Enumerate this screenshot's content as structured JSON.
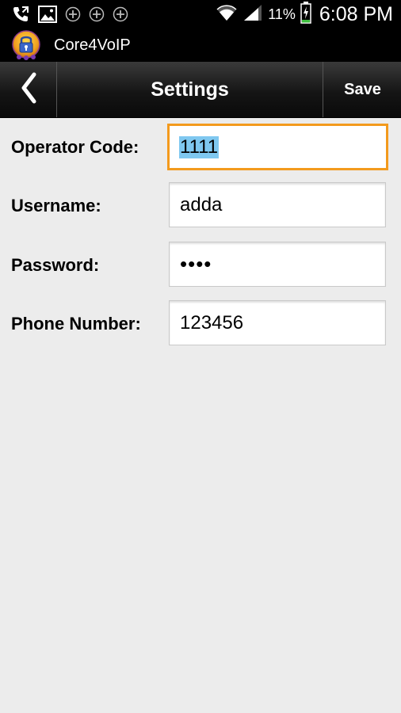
{
  "status_bar": {
    "battery_percent": "11%",
    "time": "6:08 PM",
    "icons": [
      "phone-call-icon",
      "image-icon",
      "add-circle-icon",
      "add-circle-icon",
      "add-circle-icon",
      "wifi-icon",
      "signal-icon",
      "battery-charging-icon"
    ]
  },
  "app": {
    "name": "Core4VoIP",
    "logo_icon": "lock-logo-icon"
  },
  "action_bar": {
    "back_icon": "chevron-left-icon",
    "title": "Settings",
    "save_label": "Save"
  },
  "form": {
    "operator_code": {
      "label": "Operator Code:",
      "value": "1111"
    },
    "username": {
      "label": "Username:",
      "value": "adda"
    },
    "password": {
      "label": "Password:",
      "value": "••••"
    },
    "phone_number": {
      "label": "Phone Number:",
      "value": "123456"
    }
  },
  "colors": {
    "focus_border": "#f39a1d",
    "selection": "#7fc8f0",
    "background": "#ececec"
  }
}
